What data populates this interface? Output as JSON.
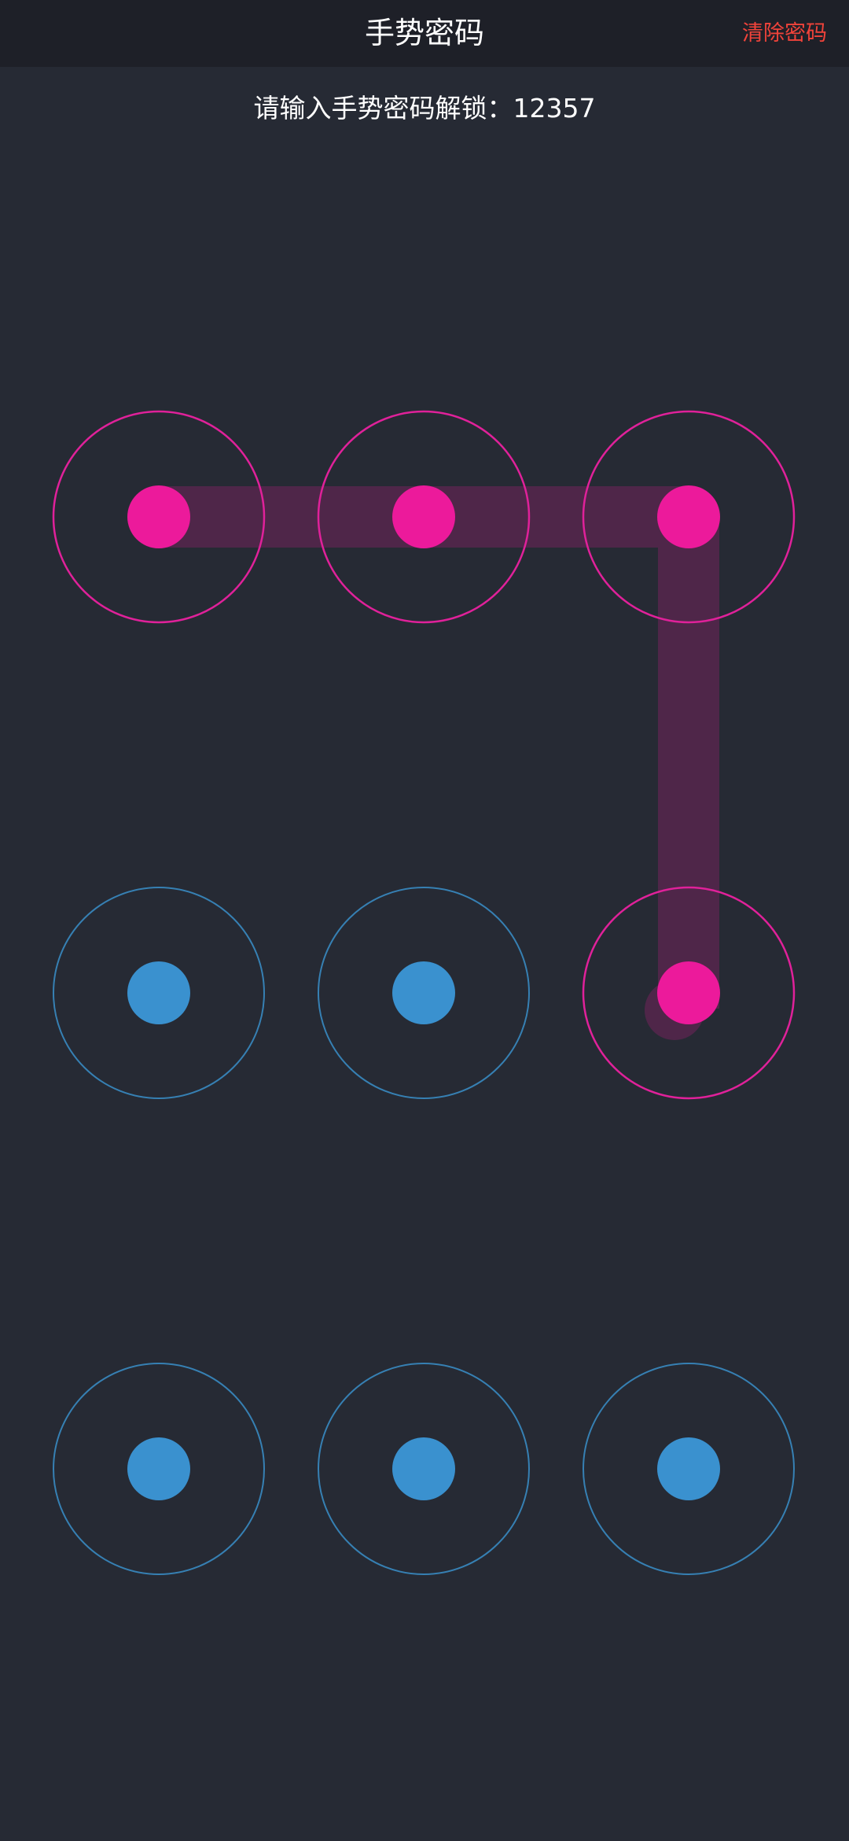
{
  "header": {
    "title": "手势密码",
    "clear_label": "清除密码"
  },
  "prompt": {
    "text": "请输入手势密码解锁：12357"
  },
  "lock": {
    "nodes": [
      {
        "id": 1,
        "selected": true
      },
      {
        "id": 2,
        "selected": true
      },
      {
        "id": 3,
        "selected": true
      },
      {
        "id": 4,
        "selected": false
      },
      {
        "id": 5,
        "selected": false
      },
      {
        "id": 6,
        "selected": true
      },
      {
        "id": 7,
        "selected": false
      },
      {
        "id": 8,
        "selected": false
      },
      {
        "id": 9,
        "selected": false
      }
    ],
    "path": [
      1,
      2,
      3,
      6
    ],
    "colors": {
      "selected": "#ec1a9b",
      "selected_ring": "#e0219a",
      "path": "#4f2649",
      "idle_dot": "#3a91cf",
      "idle_ring": "#3a8fca"
    }
  }
}
